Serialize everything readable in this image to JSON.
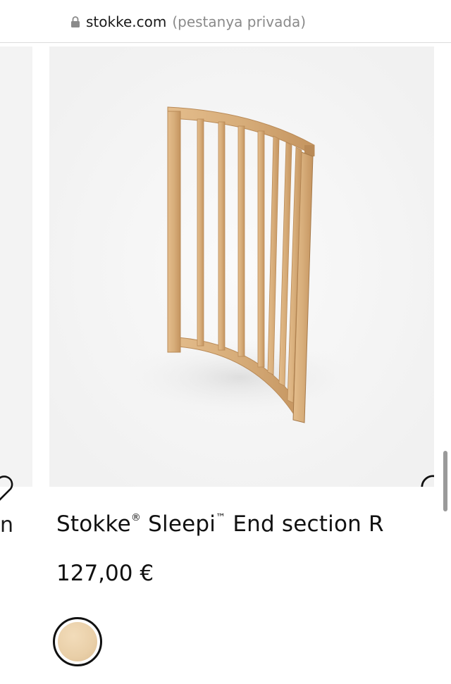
{
  "browser": {
    "domain": "stokke.com",
    "private_label": "(pestanya privada)",
    "lock_icon": "lock-icon"
  },
  "carousel": {
    "previous_title_fragment": "n",
    "previous_heart_icon": "heart-outline-icon"
  },
  "product": {
    "brand": "Stokke",
    "brand_mark": "®",
    "line": "Sleepi",
    "line_mark": "™",
    "name_suffix": "End section R",
    "price": "127,00 €",
    "image": "curved-wooden-end-section",
    "wishlist_icon": "heart-outline-icon",
    "color_swatch": "natural-wood-swatch"
  },
  "colors": {
    "card_background": "#f3f3f3",
    "wood": "#d9b080",
    "wood_dark": "#b98a57",
    "swatch": "#e9cfa8"
  }
}
